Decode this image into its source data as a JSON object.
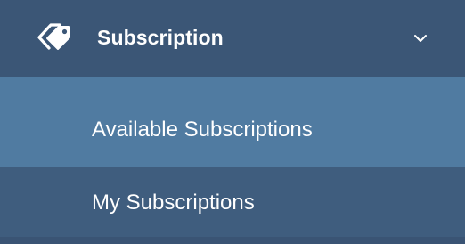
{
  "menu": {
    "header": {
      "icon": "tags-icon",
      "label": "Subscription",
      "expand_icon": "chevron-down-icon"
    },
    "items": [
      {
        "label": "Available Subscriptions",
        "active": true
      },
      {
        "label": "My Subscriptions",
        "active": false
      }
    ]
  },
  "colors": {
    "header_bg": "#3b5676",
    "active_bg": "#507ba1",
    "item_bg": "#3f5d7e",
    "text": "#ffffff"
  }
}
